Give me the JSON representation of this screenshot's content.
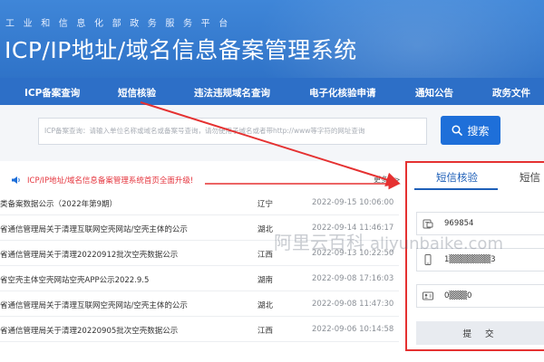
{
  "header": {
    "ministry_text": "工业和信息化部政务服务平台",
    "system_title": "ICP/IP地址/域名信息备案管理系统"
  },
  "nav": {
    "items": [
      {
        "label": "ICP备案查询"
      },
      {
        "label": "短信核验"
      },
      {
        "label": "违法违规域名查询"
      },
      {
        "label": "电子化核验申请"
      },
      {
        "label": "通知公告"
      },
      {
        "label": "政务文件"
      }
    ]
  },
  "search": {
    "placeholder": "ICP备案查询：请输入单位名称或域名或备案号查询，请勿使用子域名或者带http://www等字符的网址查询",
    "button_label": "搜索",
    "icon": "search-icon"
  },
  "notice": {
    "icon": "speaker-icon",
    "text": "ICP/IP地址/域名信息备案管理系统首页全面升级!",
    "more_label": "更多>>"
  },
  "list": {
    "rows": [
      {
        "title": "类备案数据公示（2022年第9期）",
        "province": "辽宁",
        "date": "2022-09-15 10:06:00"
      },
      {
        "title": "省通信管理局关于清理互联网空壳网站/空壳主体的公示",
        "province": "湖北",
        "date": "2022-09-14 11:46:17"
      },
      {
        "title": "省通信管理局关于清理20220912批次空壳数据公示",
        "province": "江西",
        "date": "2022-09-13 10:22:50"
      },
      {
        "title": "省空壳主体空壳网站空壳APP公示2022.9.5",
        "province": "湖南",
        "date": "2022-09-08 17:16:03"
      },
      {
        "title": "省通信管理局关于清理互联网空壳网站/空壳主体的公示",
        "province": "湖北",
        "date": "2022-09-08 11:47:30"
      },
      {
        "title": "省通信管理局关于清理20220905批次空壳数据公示",
        "province": "江西",
        "date": "2022-09-06 10:14:58"
      }
    ]
  },
  "panel": {
    "tabs": [
      {
        "label": "短信核验"
      },
      {
        "label": "短信"
      }
    ],
    "fields": [
      {
        "icon": "verification-code-icon",
        "value": "969854"
      },
      {
        "icon": "mobile-phone-icon",
        "value": "1▒▒▒▒▒▒▒3"
      },
      {
        "icon": "id-card-icon",
        "value": "0▒▒▒0"
      }
    ],
    "submit_label": "提 交",
    "highlight_color": "#e53131"
  },
  "watermark": {
    "cn": "阿里云百科",
    "en": "aliyunbaike.com"
  },
  "colors": {
    "banner": "#2f73c8",
    "nav": "#2d6fc7",
    "accent": "#1e6fd9",
    "notice_red": "#e5343d",
    "annotation_red": "#e53131"
  }
}
